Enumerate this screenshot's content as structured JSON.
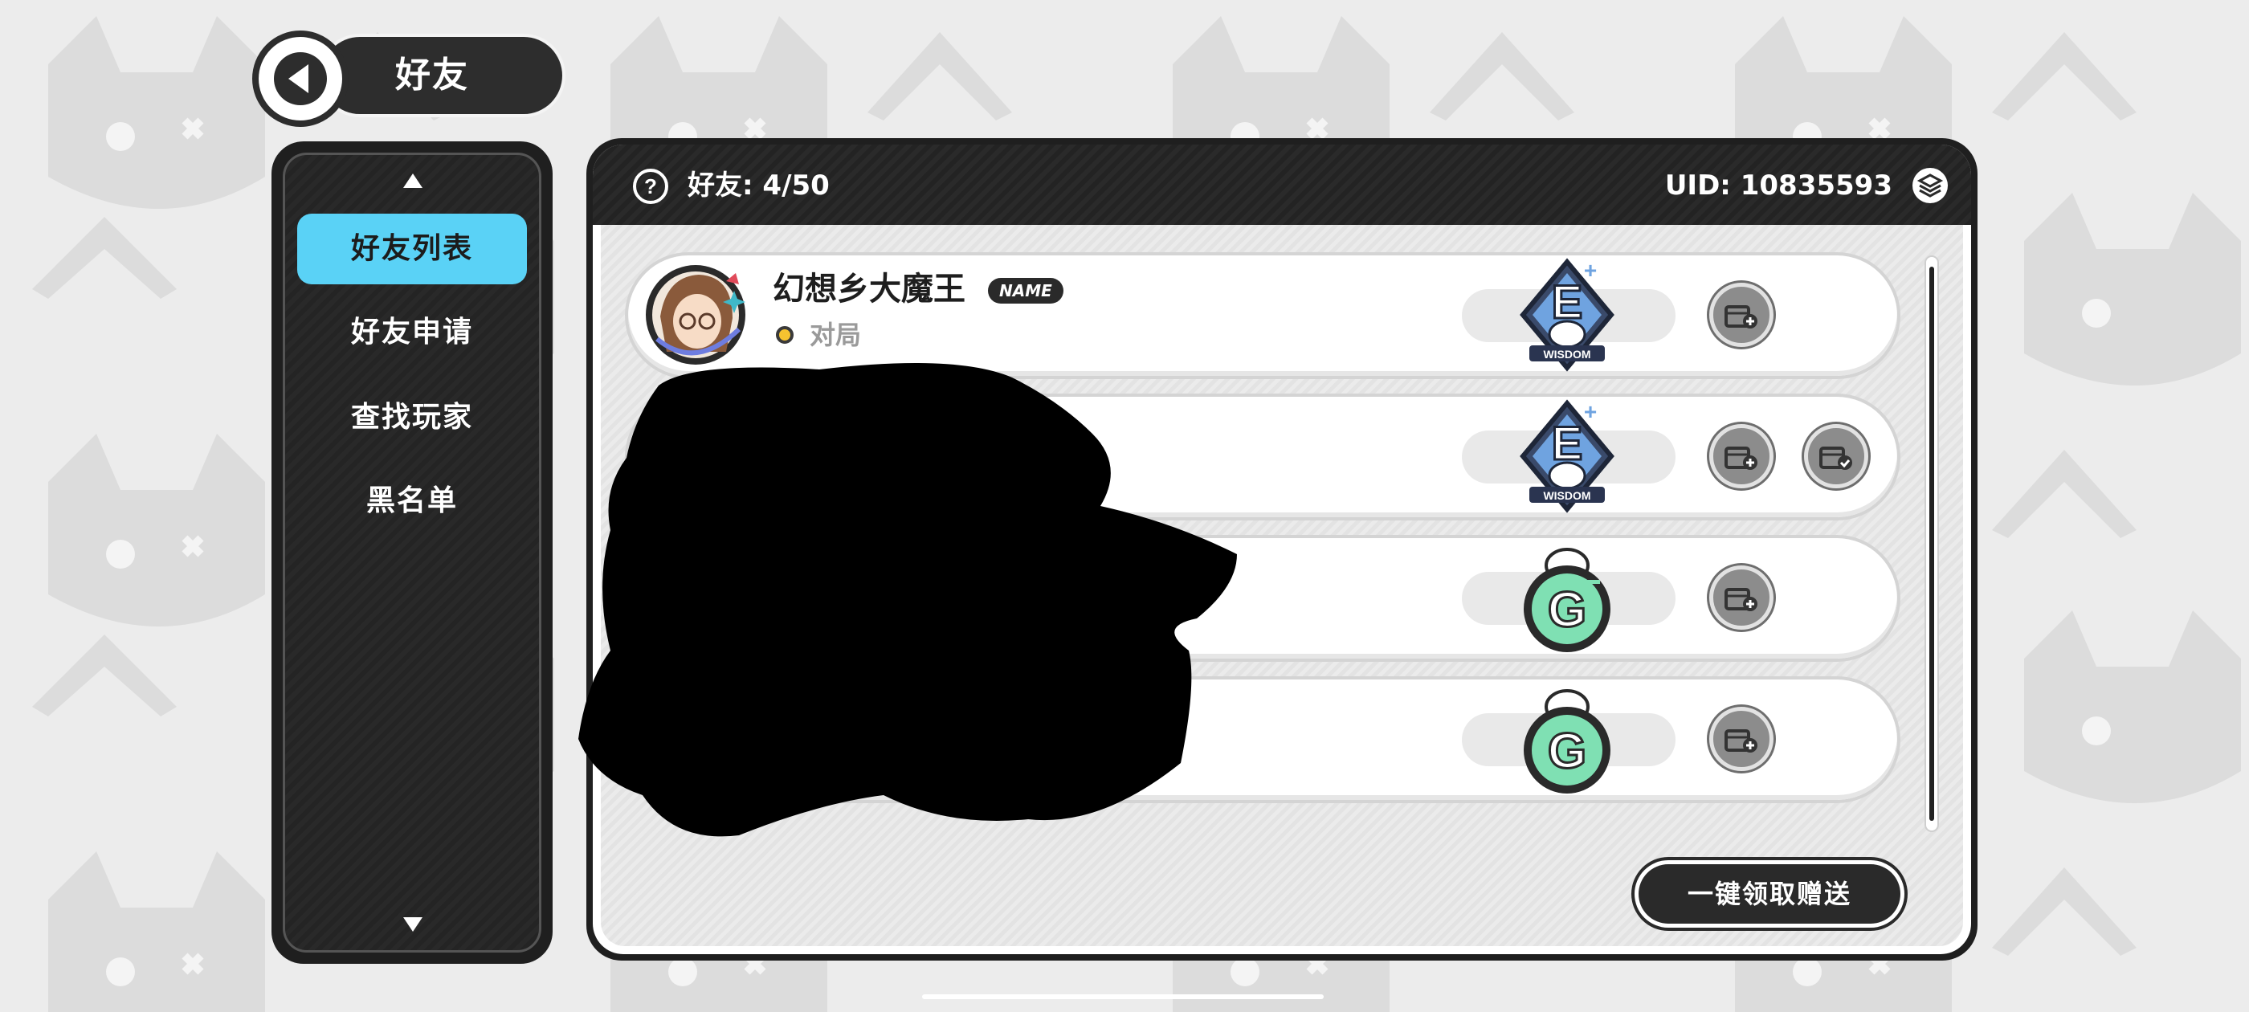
{
  "header": {
    "title": "好友",
    "back_icon": "back-arrow-icon"
  },
  "sidebar": {
    "up_icon": "triangle-up-icon",
    "down_icon": "triangle-down-icon",
    "items": [
      {
        "label": "好友列表",
        "active": true
      },
      {
        "label": "好友申请",
        "active": false
      },
      {
        "label": "查找玩家",
        "active": false
      },
      {
        "label": "黑名单",
        "active": false
      }
    ]
  },
  "panel": {
    "friend_count_label": "好友: 4/50",
    "uid_label": "UID: 10835593",
    "help_icon": "help-icon",
    "layers_icon": "layers-icon"
  },
  "friends": [
    {
      "name": "幻想乡大魔王",
      "tag": "NAME",
      "status": "对局",
      "status_color": "#f6c330",
      "rank": "E+",
      "rank_banner": "WISDOM",
      "actions": [
        "send-gift-icon"
      ]
    },
    {
      "name": "",
      "tag": "",
      "status": "",
      "rank": "E+",
      "rank_banner": "WISDOM",
      "actions": [
        "send-gift-icon",
        "receive-gift-icon"
      ]
    },
    {
      "name": "",
      "tag": "",
      "status": "",
      "rank": "G-",
      "rank_banner": "",
      "actions": [
        "send-gift-icon"
      ]
    },
    {
      "name": "",
      "tag": "",
      "status": "",
      "rank": "G",
      "rank_banner": "",
      "actions": [
        "send-gift-icon"
      ]
    }
  ],
  "footer": {
    "claim_all_label": "一键领取赠送"
  },
  "colors": {
    "accent": "#5ad2f6",
    "dark": "#2a2a2a",
    "rank_e": "#6fa3e0",
    "rank_g": "#7fe0b3"
  }
}
